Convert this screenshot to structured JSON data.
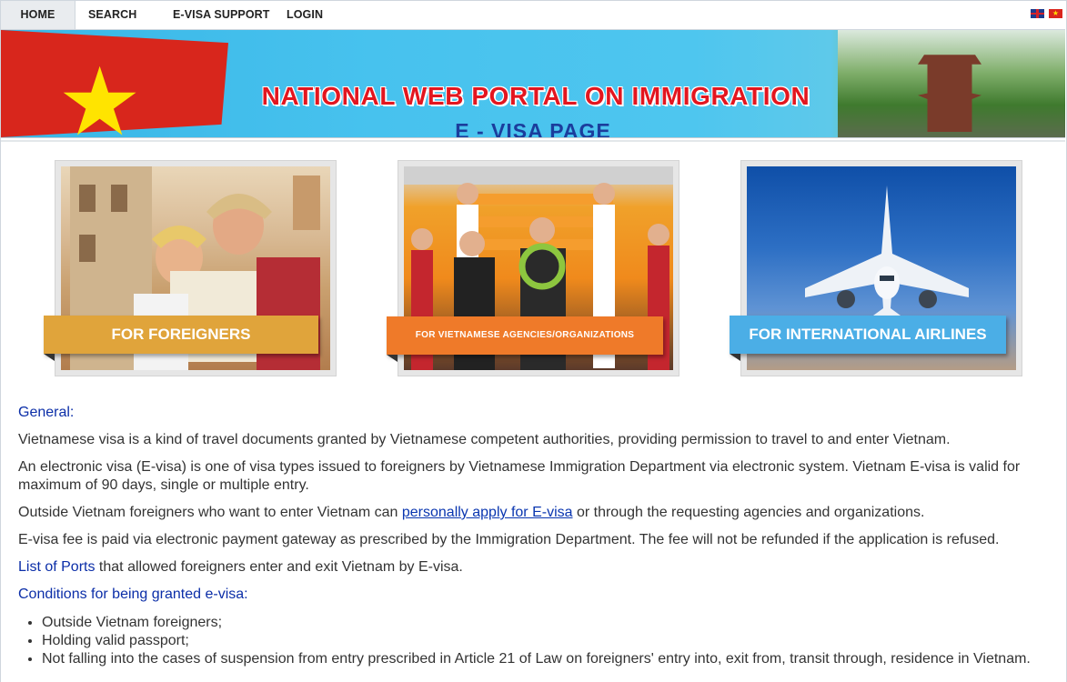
{
  "nav": {
    "items": [
      "HOME",
      "SEARCH",
      "E-VISA SUPPORT",
      "LOGIN"
    ],
    "languages": [
      "English",
      "Vietnamese"
    ]
  },
  "banner": {
    "title": "NATIONAL WEB PORTAL ON IMMIGRATION",
    "subtitle": "E - VISA PAGE"
  },
  "cards": [
    {
      "label": "FOR FOREIGNERS",
      "color": "#e0a43b"
    },
    {
      "label": "FOR VIETNAMESE AGENCIES/ORGANIZATIONS",
      "color": "#ef7a29"
    },
    {
      "label": "FOR INTERNATIONAL AIRLINES",
      "color": "#4baee6"
    }
  ],
  "content": {
    "general_heading": "General:",
    "p1": "Vietnamese visa is a kind of travel documents granted by Vietnamese competent authorities, providing permission to travel to and enter Vietnam.",
    "p2": "An electronic visa (E-visa) is one of visa types issued to foreigners by Vietnamese Immigration Department via electronic system. Vietnam E-visa is valid for maximum of 90 days, single or multiple entry.",
    "p3_before": "Outside Vietnam foreigners who want to enter Vietnam can ",
    "p3_link": "personally apply for E-visa",
    "p3_after": " or through the requesting agencies and organizations.",
    "p4": "E-visa fee is paid via electronic payment gateway as prescribed by the Immigration Department. The fee will not be refunded if the application is refused.",
    "p5_link": "List of Ports",
    "p5_after": " that allowed foreigners enter and exit Vietnam by E-visa.",
    "conditions_heading": "Conditions for being granted e-visa:",
    "conditions": [
      "Outside Vietnam foreigners;",
      "Holding valid passport;",
      "Not falling into the cases of suspension from entry prescribed in Article 21 of Law on foreigners' entry into, exit from, transit through, residence in Vietnam."
    ]
  }
}
